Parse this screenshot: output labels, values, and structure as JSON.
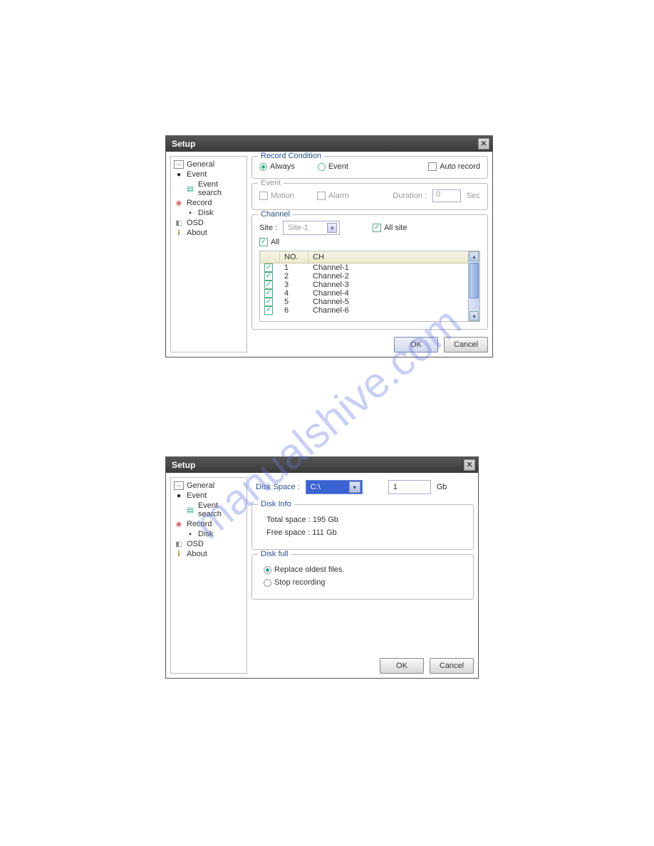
{
  "watermark": "manualshive.com",
  "dialog1": {
    "title": "Setup",
    "tree": {
      "general": "General",
      "event": "Event",
      "event_search": "Event search",
      "record": "Record",
      "disk": "Disk",
      "osd": "OSD",
      "about": "About"
    },
    "record_condition": {
      "legend": "Record Condition",
      "always": "Always",
      "event": "Event",
      "auto_record": "Auto record"
    },
    "event_group": {
      "legend": "Event",
      "motion": "Motion",
      "alarm": "Alarm",
      "duration_label": "Duration :",
      "duration_value": "0",
      "sec": "Sec"
    },
    "channel_group": {
      "legend": "Channel",
      "site_label": "Site :",
      "site_value": "Site-1",
      "all_site": "All site",
      "all": "All",
      "col_no": "NO.",
      "col_ch": "CH",
      "rows": [
        {
          "no": "1",
          "ch": "Channel-1"
        },
        {
          "no": "2",
          "ch": "Channel-2"
        },
        {
          "no": "3",
          "ch": "Channel-3"
        },
        {
          "no": "4",
          "ch": "Channel-4"
        },
        {
          "no": "5",
          "ch": "Channel-5"
        },
        {
          "no": "6",
          "ch": "Channel-6"
        }
      ]
    },
    "ok": "OK",
    "cancel": "Cancel"
  },
  "dialog2": {
    "title": "Setup",
    "tree": {
      "general": "General",
      "event": "Event",
      "event_search": "Event search",
      "record": "Record",
      "disk": "Disk",
      "osd": "OSD",
      "about": "About"
    },
    "disk_space_label": "Disk Space :",
    "drive": "C:\\",
    "size_value": "1",
    "size_unit": "Gb",
    "disk_info": {
      "legend": "Disk Info",
      "total": "Total space : 195 Gb",
      "free": "Free space : 111 Gb"
    },
    "disk_full": {
      "legend": "Disk full",
      "replace": "Replace oldest files.",
      "stop": "Stop recording"
    },
    "ok": "OK",
    "cancel": "Cancel"
  }
}
